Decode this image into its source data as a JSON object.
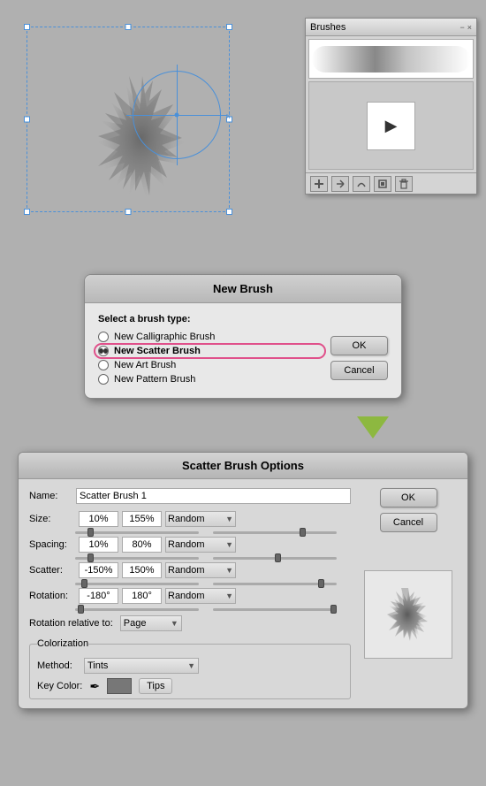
{
  "brushes_panel": {
    "title": "Brushes",
    "close": "×",
    "toolbar_icons": [
      "new",
      "delete",
      "brush-options",
      "move-to-swatch",
      "delete-brush"
    ]
  },
  "new_brush_dialog": {
    "title": "New Brush",
    "select_label": "Select a brush type:",
    "options": [
      {
        "id": "calligraphic",
        "label": "New Calligraphic Brush",
        "selected": false
      },
      {
        "id": "scatter",
        "label": "New Scatter Brush",
        "selected": true
      },
      {
        "id": "art",
        "label": "New Art Brush",
        "selected": false
      },
      {
        "id": "pattern",
        "label": "New Pattern Brush",
        "selected": false
      }
    ],
    "ok_label": "OK",
    "cancel_label": "Cancel"
  },
  "scatter_dialog": {
    "title": "Scatter Brush Options",
    "name_label": "Name:",
    "name_value": "Scatter Brush 1",
    "ok_label": "OK",
    "cancel_label": "Cancel",
    "params": [
      {
        "label": "Size:",
        "val1": "10%",
        "val2": "155%",
        "dropdown": "Random"
      },
      {
        "label": "Spacing:",
        "val1": "10%",
        "val2": "80%",
        "dropdown": "Random"
      },
      {
        "label": "Scatter:",
        "val1": "-150%",
        "val2": "150%",
        "dropdown": "Random"
      },
      {
        "label": "Rotation:",
        "val1": "-180°",
        "val2": "180°",
        "dropdown": "Random"
      }
    ],
    "rotation_relative_label": "Rotation relative to:",
    "rotation_relative_value": "Page",
    "colorization_label": "Colorization",
    "method_label": "Method:",
    "method_value": "Tints",
    "keycolor_label": "Key Color:",
    "tips_label": "Tips"
  }
}
